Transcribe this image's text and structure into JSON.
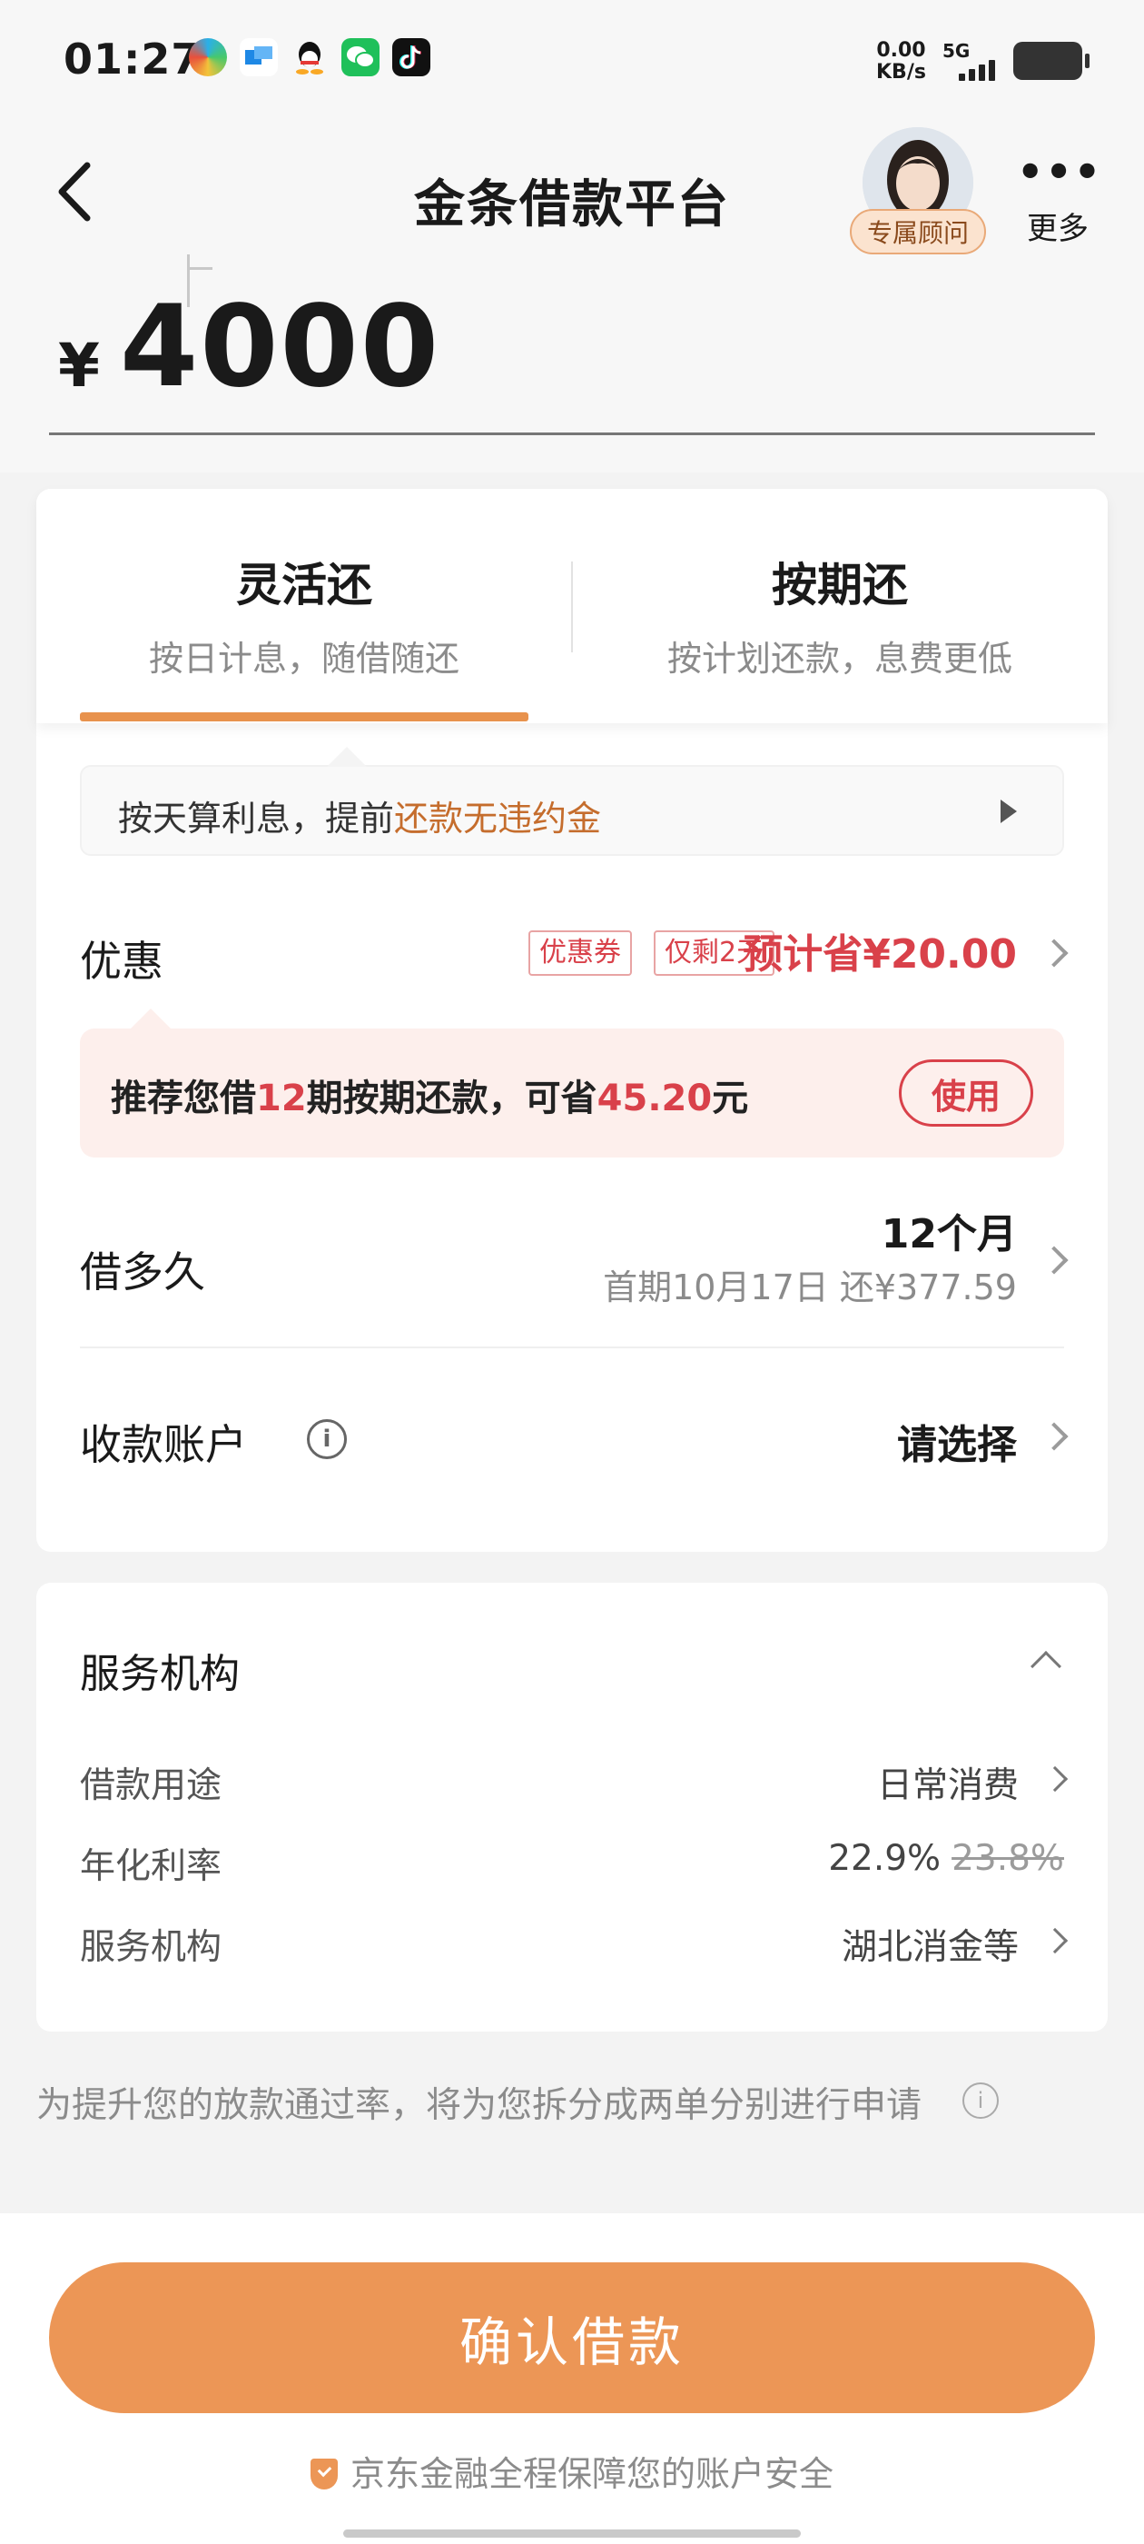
{
  "status_bar": {
    "time": "01:27",
    "net_speed_value": "0.00",
    "net_speed_unit": "KB/s",
    "network": "5G",
    "app_icons": [
      "browser-icon",
      "docs-icon",
      "qq-icon",
      "wechat-icon",
      "tiktok-icon"
    ]
  },
  "nav": {
    "title": "金条借款平台",
    "advisor_label": "专属顾问",
    "more_label": "更多"
  },
  "amount": {
    "currency": "¥",
    "value": "4000"
  },
  "repay_tabs": [
    {
      "title": "灵活还",
      "subtitle": "按日计息，随借随还",
      "selected": true
    },
    {
      "title": "按期还",
      "subtitle": "按计划还款，息费更低",
      "selected": false
    }
  ],
  "interest_tip": {
    "prefix": "按天算利息，提前",
    "highlight": "还款无违约金"
  },
  "promo": {
    "label": "优惠",
    "tag_coupon": "优惠券",
    "tag_days": "仅剩2天",
    "estimate": "预计省¥20.00"
  },
  "recommend": {
    "part1": "推荐您借",
    "periods": "12",
    "part2": "期按期还款，可省",
    "amount": "45.20",
    "part3": "元",
    "button": "使用"
  },
  "term": {
    "label": "借多久",
    "value": "12个月",
    "first_payment": "首期10月17日 还¥377.59"
  },
  "account": {
    "label": "收款账户",
    "info_icon": "i",
    "value": "请选择"
  },
  "service": {
    "title": "服务机构",
    "rows": [
      {
        "key": "借款用途",
        "value": "日常消费"
      },
      {
        "key": "年化利率",
        "value": "22.9%",
        "original": "23.8%"
      },
      {
        "key": "服务机构",
        "value": "湖北消金等"
      }
    ]
  },
  "note": "为提升您的放款通过率，将为您拆分成两单分别进行申请",
  "footer": {
    "confirm_label": "确认借款",
    "security_text": "京东金融全程保障您的账户安全"
  },
  "colors": {
    "accent_orange": "#ec9656",
    "promo_red": "#d9414a",
    "tip_highlight": "#c56d2d"
  }
}
